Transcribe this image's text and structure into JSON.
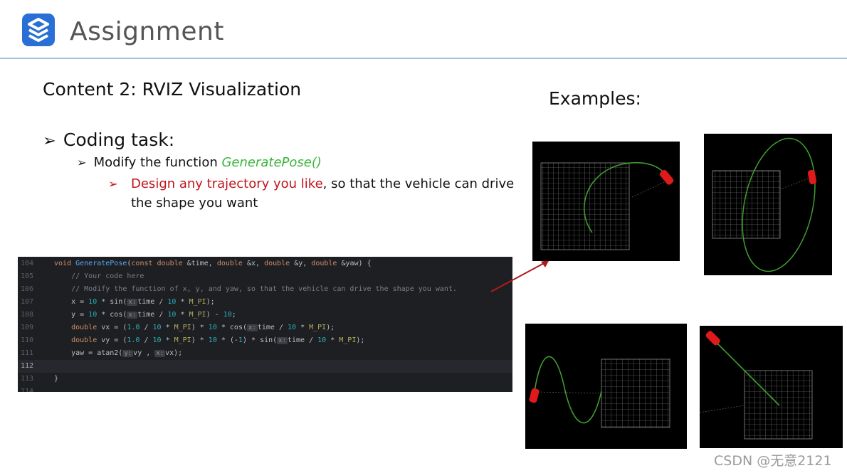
{
  "header": {
    "title": "Assignment"
  },
  "content": {
    "heading": "Content 2:  RVIZ Visualization",
    "examples_label": "Examples:",
    "task": "Coding task:",
    "sub_prefix": "Modify the function ",
    "sub_func": "GeneratePose()",
    "red_text": "Design any trajectory you like",
    "rest_text": ", so that the vehicle can drive the shape you want"
  },
  "code": {
    "line_numbers": [
      "104",
      "105",
      "106",
      "107",
      "108",
      "109",
      "110",
      "111",
      "112",
      "113",
      "114"
    ],
    "highlighted_line": "112"
  },
  "watermark": "CSDN @无意2121",
  "colors": {
    "accent_blue": "#2a6fd6",
    "trajectory_green": "#3f9e2f",
    "vehicle_red": "#e0191b",
    "grid": "#9a9a9a"
  }
}
